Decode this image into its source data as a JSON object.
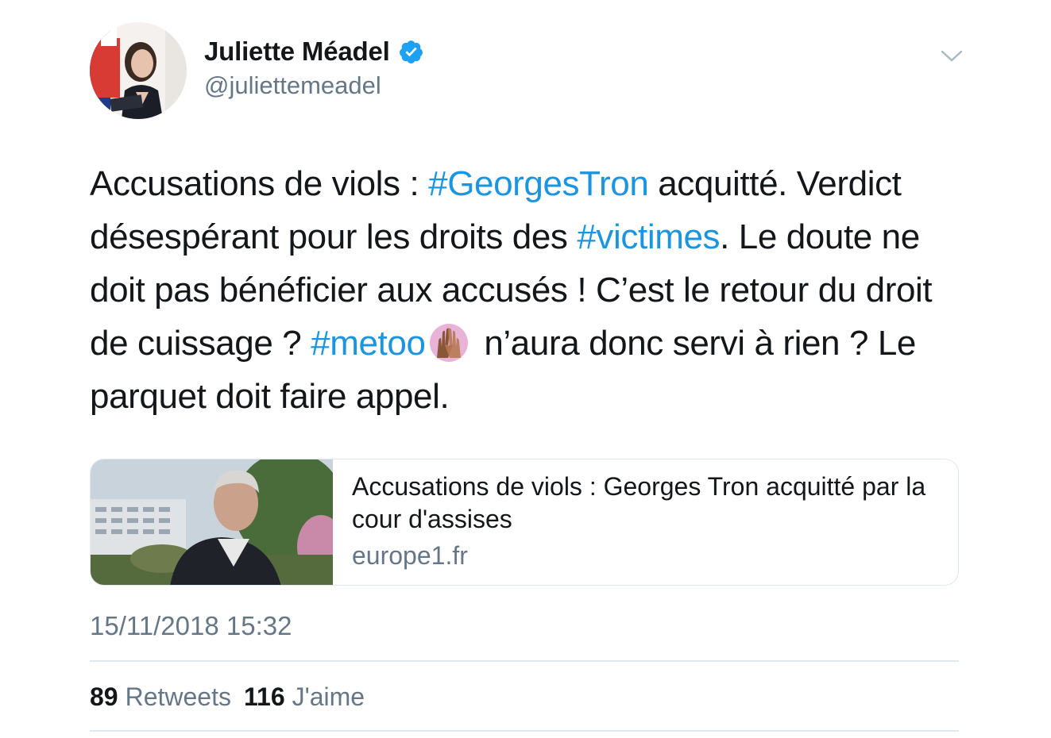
{
  "author": {
    "display_name": "Juliette Méadel",
    "handle": "@juliettemeadel",
    "verified": true
  },
  "tweet": {
    "segments": [
      {
        "text": "Accusations de viols : "
      },
      {
        "text": "#GeorgesTron",
        "hashtag": true
      },
      {
        "text": " acquitté. Verdict désespérant pour les droits des "
      },
      {
        "text": "#victimes",
        "hashtag": true
      },
      {
        "text": ". Le doute ne doit pas bénéficier aux accusés ! C’est le retour du droit de cuissage ? "
      },
      {
        "text": "#metoo",
        "hashtag": true
      },
      {
        "emoji": "raised-hands-emoji"
      },
      {
        "text": " n’aura donc servi à rien ? Le parquet doit faire appel."
      }
    ]
  },
  "card": {
    "title": "Accusations de viols : Georges Tron acquitté par la cour d'assises",
    "domain": "europe1.fr"
  },
  "timestamp": "15/11/2018 15:32",
  "stats": {
    "retweets_count": "89",
    "retweets_label": "Retweets",
    "likes_count": "116",
    "likes_label": "J'aime"
  },
  "colors": {
    "hashtag": "#1b95e0",
    "secondary_text": "#657786",
    "verified_badge": "#1da1f2",
    "border": "#e1e8ed"
  }
}
